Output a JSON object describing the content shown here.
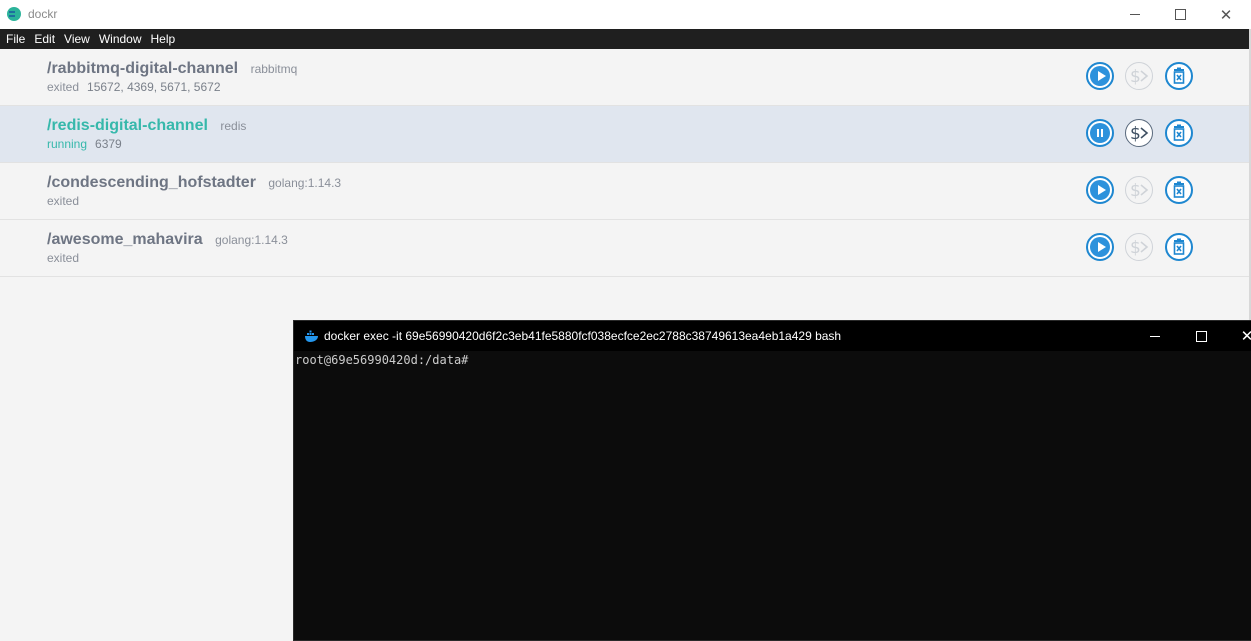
{
  "app": {
    "title": "dockr"
  },
  "window_controls": {
    "minimize": "–",
    "maximize": "□",
    "close": "✕"
  },
  "menu": [
    "File",
    "Edit",
    "View",
    "Window",
    "Help"
  ],
  "containers": [
    {
      "name": "/rabbitmq-digital-channel",
      "image": "rabbitmq",
      "status": "exited",
      "ports": "15672, 4369, 5671, 5672",
      "running": false
    },
    {
      "name": "/redis-digital-channel",
      "image": "redis",
      "status": "running",
      "ports": "6379",
      "running": true
    },
    {
      "name": "/condescending_hofstadter",
      "image": "golang:1.14.3",
      "status": "exited",
      "ports": "",
      "running": false
    },
    {
      "name": "/awesome_mahavira",
      "image": "golang:1.14.3",
      "status": "exited",
      "ports": "",
      "running": false
    }
  ],
  "icons": {
    "start": "play-icon",
    "pause": "pause-icon",
    "shell": "shell-icon",
    "remove": "trash-icon"
  },
  "terminal": {
    "title": "docker  exec -it 69e56990420d6f2c3eb41fe5880fcf038ecfce2ec2788c38749613ea4eb1a429 bash",
    "prompt": "root@69e56990420d:/data#"
  },
  "colors": {
    "accent_blue": "#1e87d0",
    "running_green": "#36b8ab",
    "menubar": "#1f1f1f",
    "active_row": "#e0e6ef"
  }
}
